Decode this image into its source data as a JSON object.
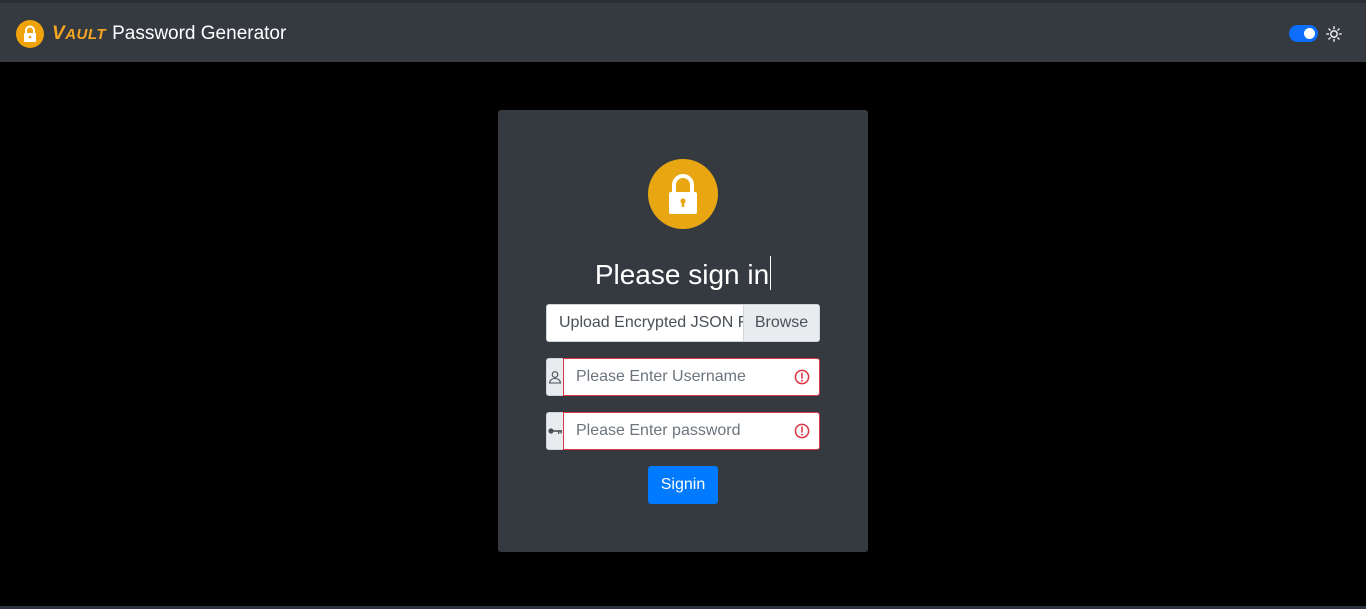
{
  "header": {
    "brand_vault_first": "V",
    "brand_vault_rest": "AULT",
    "brand_title": "Password Generator",
    "theme_toggle_on": true,
    "logo_icon": "lock-icon",
    "theme_icon": "sun-icon"
  },
  "login": {
    "heading": "Please sign in",
    "file_label": "Upload Encrypted JSON File",
    "browse_label": "Browse",
    "username_placeholder": "Please Enter Username",
    "password_placeholder": "Please Enter password",
    "signin_label": "Signin",
    "username_icon": "user-icon",
    "password_icon": "key-icon",
    "error_icon": "exclamation-circle-icon"
  },
  "colors": {
    "accent": "#e8a712",
    "primary": "#007bff",
    "error": "#dc3545",
    "panel": "#343a40"
  }
}
